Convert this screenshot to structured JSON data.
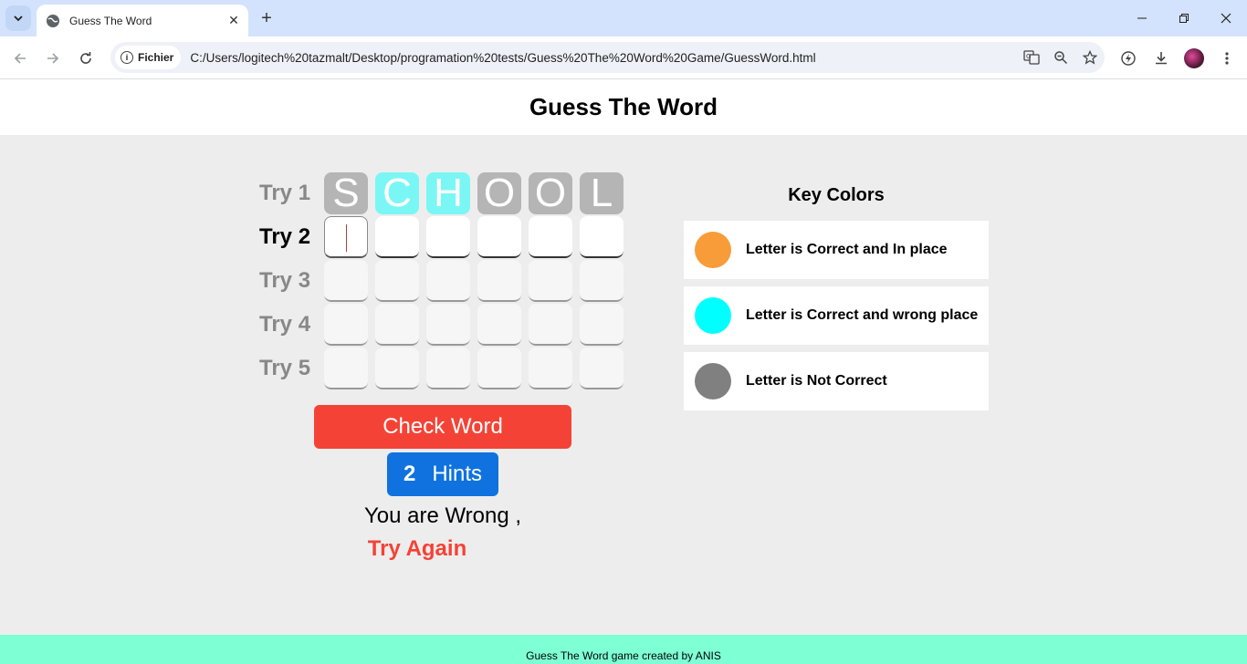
{
  "browser": {
    "tab_title": "Guess The Word",
    "site_chip": "Fichier",
    "url": "C:/Users/logitech%20tazmalt/Desktop/programation%20tests/Guess%20The%20Word%20Game/GuessWord.html"
  },
  "header": {
    "title": "Guess The Word"
  },
  "game": {
    "tries": [
      {
        "label": "Try 1",
        "letters": [
          "S",
          "C",
          "H",
          "O",
          "O",
          "L"
        ],
        "states": [
          "grey",
          "cyan",
          "cyan",
          "grey",
          "grey",
          "grey"
        ]
      },
      {
        "label": "Try 2",
        "letters": [
          "",
          "",
          "",
          "",
          "",
          ""
        ],
        "states": [
          "active",
          "active",
          "active",
          "active",
          "active",
          "active"
        ]
      },
      {
        "label": "Try 3",
        "letters": [
          "",
          "",
          "",
          "",
          "",
          ""
        ],
        "states": [
          "disabled",
          "disabled",
          "disabled",
          "disabled",
          "disabled",
          "disabled"
        ]
      },
      {
        "label": "Try 4",
        "letters": [
          "",
          "",
          "",
          "",
          "",
          ""
        ],
        "states": [
          "disabled",
          "disabled",
          "disabled",
          "disabled",
          "disabled",
          "disabled"
        ]
      },
      {
        "label": "Try 5",
        "letters": [
          "",
          "",
          "",
          "",
          "",
          ""
        ],
        "states": [
          "disabled",
          "disabled",
          "disabled",
          "disabled",
          "disabled",
          "disabled"
        ]
      }
    ],
    "check_button": "Check Word",
    "hints_count": "2",
    "hints_label": "Hints",
    "message_wrong": "You are Wrong ,",
    "message_try_again": "Try Again"
  },
  "key_colors": {
    "title": "Key Colors",
    "items": [
      {
        "label": "Letter is Correct and In place",
        "color": "#f89c3a"
      },
      {
        "label": "Letter is Correct and wrong place",
        "color": "#00ffff"
      },
      {
        "label": "Letter is Not Correct",
        "color": "#808080"
      }
    ]
  },
  "footer": {
    "text": "Guess The Word game created by ANIS"
  }
}
